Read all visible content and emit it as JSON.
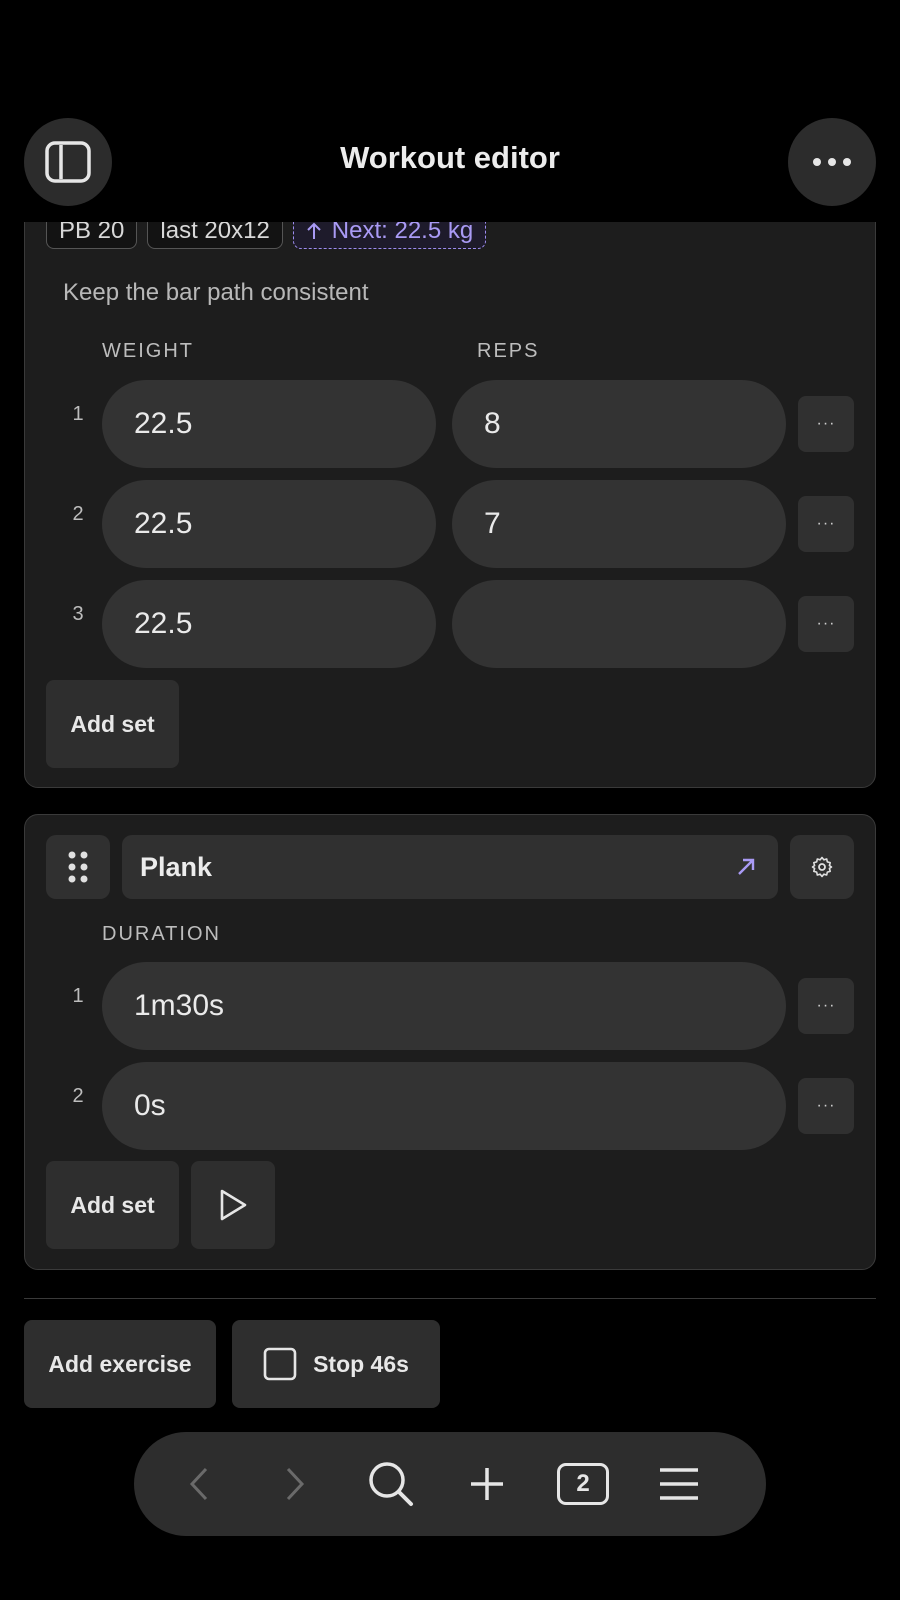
{
  "header": {
    "title": "Workout editor",
    "left_icon": "sidebar-toggle-icon",
    "right_icon": "ellipsis-icon"
  },
  "exercise1": {
    "chips": {
      "pb": "PB 20",
      "last": "last 20x12",
      "next": "Next: 22.5 kg"
    },
    "note": "Keep the bar path consistent",
    "columns": {
      "weight": "WEIGHT",
      "reps": "REPS"
    },
    "sets": [
      {
        "num": "1",
        "weight": "22.5",
        "reps": "8"
      },
      {
        "num": "2",
        "weight": "22.5",
        "reps": "7"
      },
      {
        "num": "3",
        "weight": "22.5",
        "reps": ""
      }
    ],
    "more_label": "···",
    "add_set": "Add set"
  },
  "exercise2": {
    "name": "Plank",
    "columns": {
      "duration": "DURATION"
    },
    "sets": [
      {
        "num": "1",
        "duration": "1m30s"
      },
      {
        "num": "2",
        "duration": "0s"
      }
    ],
    "more_label": "···",
    "add_set": "Add set"
  },
  "footer_actions": {
    "add_exercise": "Add exercise",
    "stop_timer": "Stop 46s"
  },
  "nav": {
    "tab_count": "2"
  },
  "colors": {
    "accent": "#a99af4",
    "background": "#000000",
    "card": "#1d1d1d",
    "field": "#333333"
  }
}
